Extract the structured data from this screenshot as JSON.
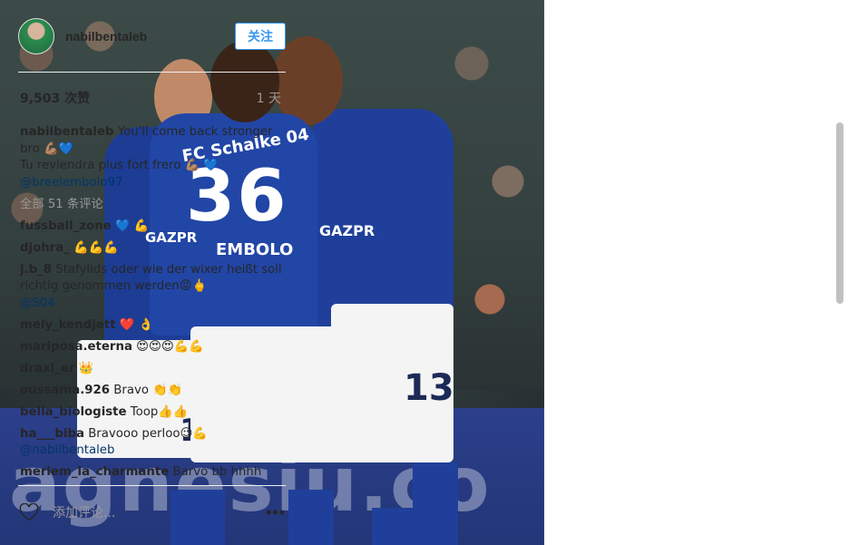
{
  "photo": {
    "jersey": {
      "club": "FC Schalke 04",
      "number": "36",
      "name": "EMBOLO",
      "sponsor": "GAZPR",
      "sponsor2": "GAZPR",
      "number_right": "13",
      "number_left": "1"
    },
    "board_text": "agnesiu.co"
  },
  "header": {
    "username": "nabilbentaleb",
    "follow_label": "关注"
  },
  "stats": {
    "views": "9,503 次赞",
    "time": "1 天"
  },
  "caption": {
    "username": "nabilbentaleb",
    "line1": "You'll come back stronger bro 💪🏽💙",
    "line2": "Tu reviendra plus fort frero 💪🏽 💙",
    "mention": "@breelembolo97"
  },
  "more_comments": "全部 51 条评论",
  "comments": [
    {
      "user": "fussball_zone",
      "text": "💙 💪"
    },
    {
      "user": "djohra_",
      "text": "💪💪💪"
    },
    {
      "user": "j.b_8",
      "text": "Stafylids oder wie der wixer heißt soll richtig genommen werden😡🖕",
      "mention": "@S04"
    },
    {
      "user": "mely_kendjett",
      "text": "❤️ 👌"
    },
    {
      "user": "mariposa.eterna",
      "text": "😍😍😍💪💪"
    },
    {
      "user": "draxl_er",
      "text": "👑"
    },
    {
      "user": "oussama.926",
      "text": "Bravo 👏👏"
    },
    {
      "user": "bella_biologiste",
      "text": "Toop👍👍"
    },
    {
      "user": "ha___biba",
      "text": "Bravooo perloo😉💪",
      "mention": "@nabilbentaleb"
    },
    {
      "user": "meriem_la_charmante",
      "text": "Barvo bb hhhh"
    }
  ],
  "actions": {
    "comment_placeholder": "添加评论...",
    "more_label": "•••"
  },
  "icons": {
    "heart": "heart-icon",
    "more": "more-options-icon"
  },
  "colors": {
    "accent": "#3897f0",
    "mention": "#003569",
    "muted": "#999999"
  }
}
